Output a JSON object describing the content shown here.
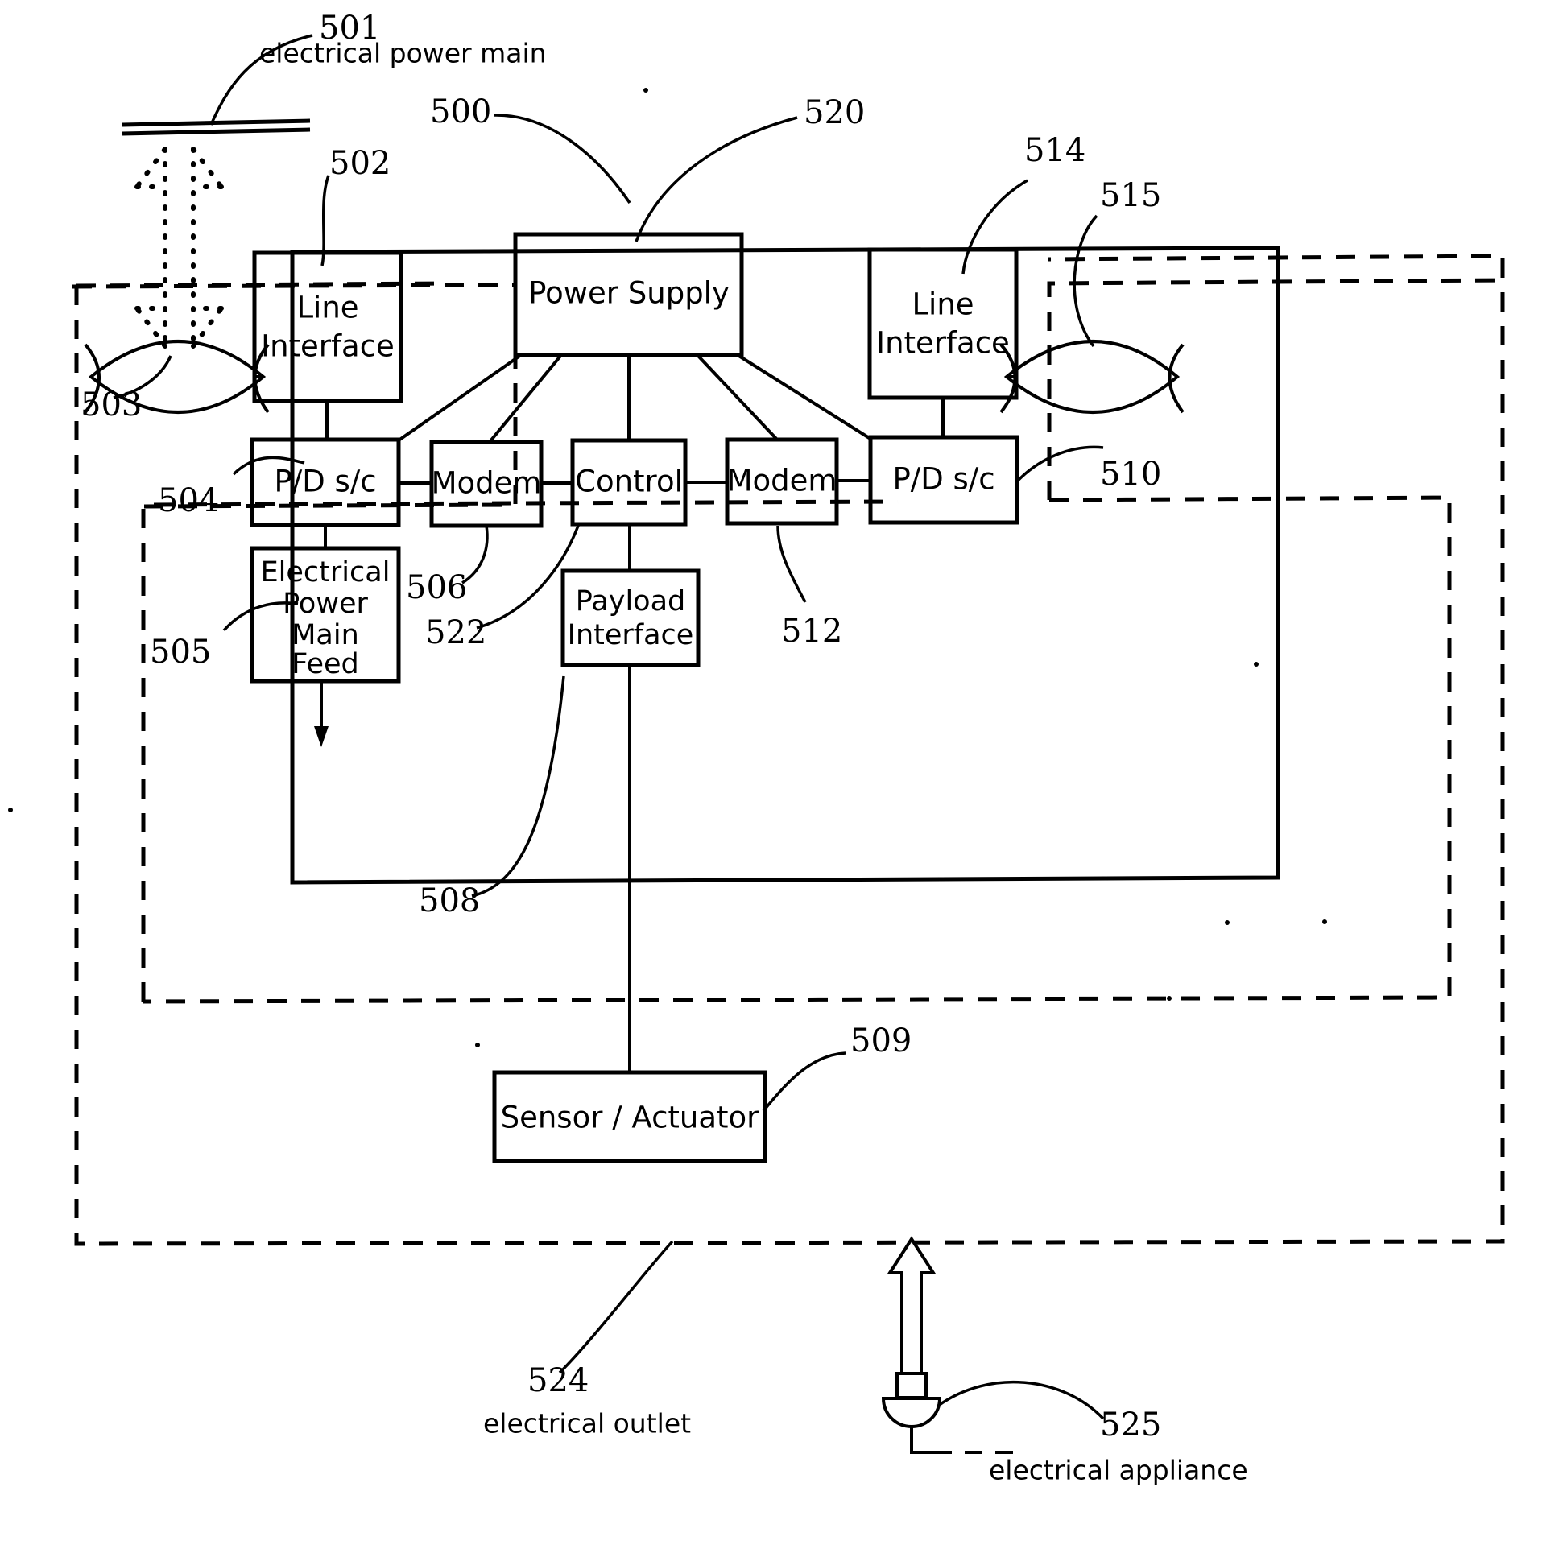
{
  "figure": {
    "title": "Power line communication node block diagram",
    "line_color": "#000000",
    "background": "#ffffff"
  },
  "blocks": {
    "line_interface_left": {
      "label_line1": "Line",
      "label_line2": "Interface"
    },
    "line_interface_right": {
      "label_line1": "Line",
      "label_line2": "Interface"
    },
    "power_supply": {
      "label": "Power Supply"
    },
    "pd_sc_left": {
      "label": "P/D s/c"
    },
    "pd_sc_right": {
      "label": "P/D s/c"
    },
    "modem_left": {
      "label": "Modem"
    },
    "modem_right": {
      "label": "Modem"
    },
    "control": {
      "label": "Control"
    },
    "electrical_power_main_feed": {
      "label_line1": "Electrical",
      "label_line2": "Power",
      "label_line3": "Main",
      "label_line4": "Feed"
    },
    "payload_interface": {
      "label_line1": "Payload",
      "label_line2": "Interface"
    },
    "sensor_actuator": {
      "label": "Sensor / Actuator"
    }
  },
  "reference_numerals": {
    "n500": "500",
    "n501": "501",
    "n502": "502",
    "n503": "503",
    "n504": "504",
    "n505": "505",
    "n506": "506",
    "n508": "508",
    "n509": "509",
    "n510": "510",
    "n512": "512",
    "n514": "514",
    "n515": "515",
    "n520": "520",
    "n522": "522",
    "n524": "524",
    "n525": "525"
  },
  "captions": {
    "electrical_power_main": "electrical power main",
    "electrical_outlet": "electrical outlet",
    "electrical_appliance": "electrical appliance"
  }
}
